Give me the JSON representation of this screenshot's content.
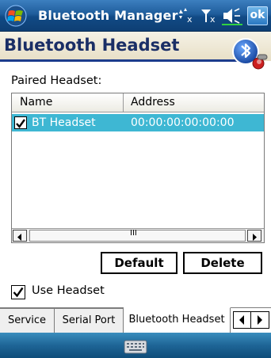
{
  "window": {
    "app_title": "Bluetooth Manager",
    "ok_label": "ok",
    "status_icons": [
      "connectivity-icon",
      "signal-off-icon",
      "volume-icon"
    ]
  },
  "header": {
    "title": "Bluetooth Headset",
    "logo_icon": "bluetooth-logo-icon"
  },
  "paired": {
    "label": "Paired Headset:"
  },
  "list": {
    "columns": [
      "Name",
      "Address"
    ],
    "rows": [
      {
        "checked": true,
        "name": "BT Headset",
        "address": "00:00:00:00:00:00",
        "selected": true
      }
    ],
    "scroll_thumb_glyph": "III"
  },
  "buttons": {
    "default_label": "Default",
    "delete_label": "Delete"
  },
  "use_headset": {
    "checked": true,
    "label": "Use Headset"
  },
  "tabs": [
    {
      "label": "Service",
      "active": false
    },
    {
      "label": "Serial Port",
      "active": false
    },
    {
      "label": "Bluetooth Headset",
      "active": true
    }
  ],
  "menubar": {
    "keyboard_icon": "keyboard-icon"
  },
  "colors": {
    "selection": "#3eb7d3",
    "title_bar": "#1f5d9c",
    "page_title": "#1a2e66"
  }
}
